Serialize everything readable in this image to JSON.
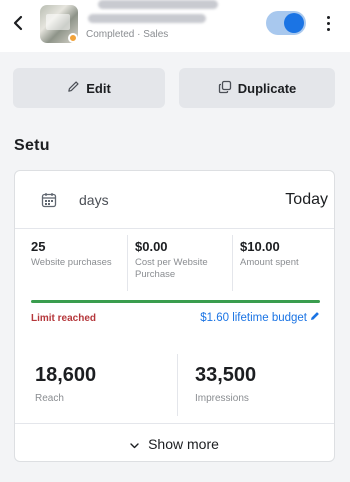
{
  "header": {
    "subtitle": "Completed · Sales",
    "toggle_on": true,
    "icons": {
      "back": "back-arrow-icon",
      "menu": "more-vertical-icon"
    },
    "colors": {
      "toggle_track": "#a8c8ee",
      "toggle_knob": "#1b74e4",
      "status_dot": "#f2a33a"
    }
  },
  "actions": {
    "edit_label": "Edit",
    "duplicate_label": "Duplicate"
  },
  "section": {
    "title": "Setu"
  },
  "summary": {
    "date_range_label": "days",
    "date_range_value": "Today",
    "metrics": [
      {
        "value": "25",
        "label": "Website purchases"
      },
      {
        "value": "$0.00",
        "label": "Cost per Website Purchase"
      },
      {
        "value": "$10.00",
        "label": "Amount spent"
      }
    ],
    "budget_progress": 1.0,
    "limit_text": "Limit reached",
    "budget_text": "$1.60 lifetime budget",
    "totals": [
      {
        "value": "18,600",
        "label": "Reach"
      },
      {
        "value": "33,500",
        "label": "Impressions"
      }
    ],
    "show_more_label": "Show more",
    "colors": {
      "limit": "#b5373b",
      "budget_link": "#1b74e4",
      "progress": "#3a9d4e"
    }
  }
}
